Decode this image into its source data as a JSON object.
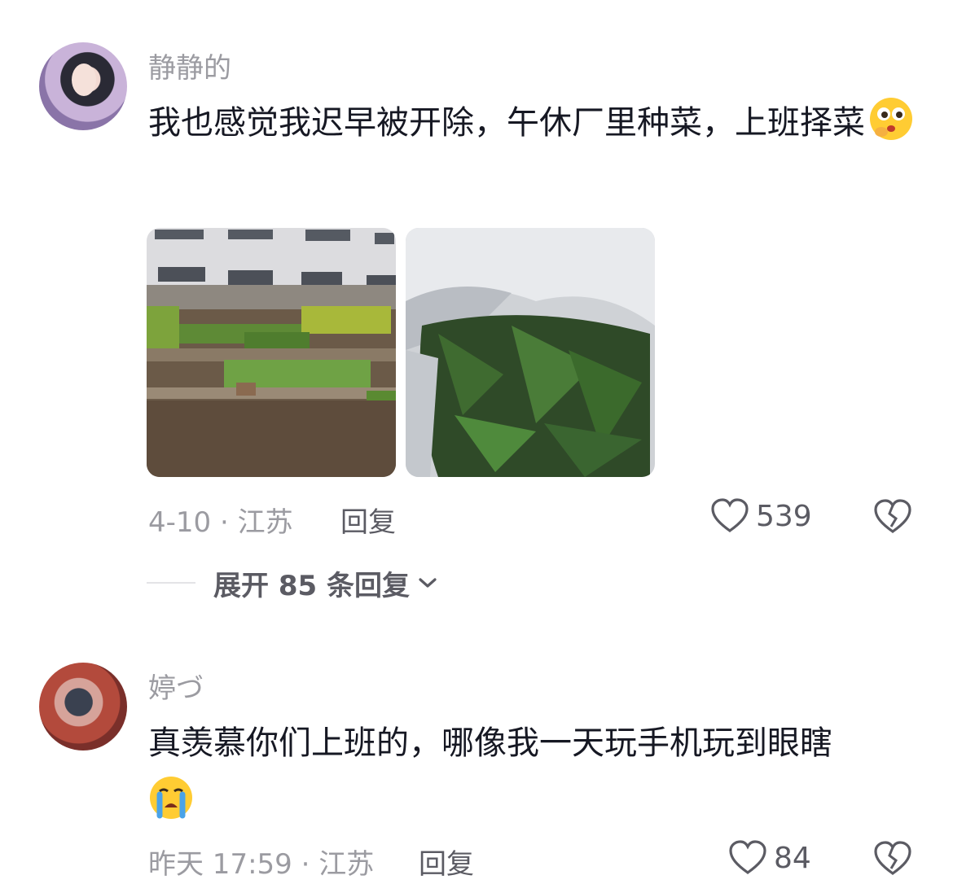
{
  "comments": [
    {
      "username": "静静的",
      "text": "我也感觉我迟早被开除，午休厂里种菜，上班择菜",
      "emoji": "thinking-face-emoji",
      "images": [
        "factory-vegetable-garden-photo",
        "leafy-greens-in-bag-photo"
      ],
      "meta": "4-10 · 江苏",
      "reply_label": "回复",
      "likes": "539",
      "expand_label": "展开 85 条回复"
    },
    {
      "username": "婷づ",
      "text": "真羡慕你们上班的，哪像我一天玩手机玩到眼瞎",
      "emoji": "crying-face-emoji",
      "meta": "昨天 17:59 · 江苏",
      "reply_label": "回复",
      "likes": "84"
    }
  ],
  "colors": {
    "text": "#161823",
    "muted": "#9b9ba1",
    "secondary": "#5b5b63"
  }
}
